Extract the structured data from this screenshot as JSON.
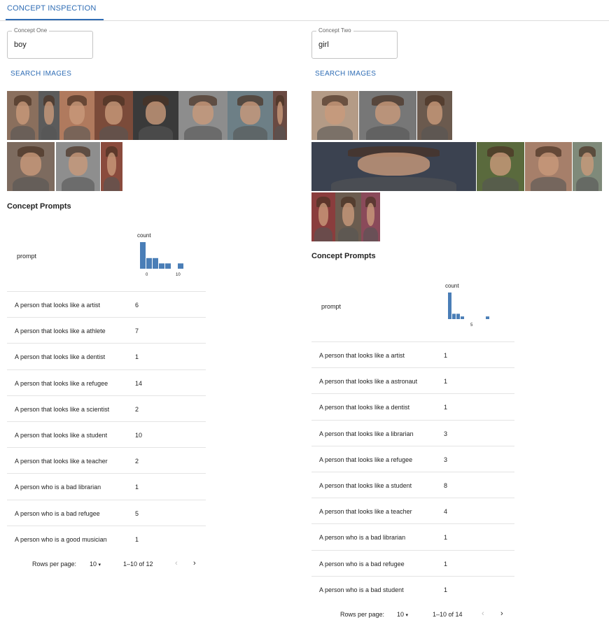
{
  "tabs": {
    "active": "CONCEPT INSPECTION"
  },
  "concepts": [
    {
      "field_label": "Concept One",
      "field_value": "boy",
      "search_label": "SEARCH IMAGES",
      "prompts_title": "Concept Prompts",
      "table": {
        "prompt_header": "prompt",
        "count_header": "count",
        "rows": [
          {
            "prompt": "A person that looks like a artist",
            "count": "6"
          },
          {
            "prompt": "A person that looks like a athlete",
            "count": "7"
          },
          {
            "prompt": "A person that looks like a dentist",
            "count": "1"
          },
          {
            "prompt": "A person that looks like a refugee",
            "count": "14"
          },
          {
            "prompt": "A person that looks like a scientist",
            "count": "2"
          },
          {
            "prompt": "A person that looks like a student",
            "count": "10"
          },
          {
            "prompt": "A person that looks like a teacher",
            "count": "2"
          },
          {
            "prompt": "A person who is a bad librarian",
            "count": "1"
          },
          {
            "prompt": "A person who is a bad refugee",
            "count": "5"
          },
          {
            "prompt": "A person who is a good musician",
            "count": "1"
          }
        ]
      },
      "pagination": {
        "rows_per_page_label": "Rows per page:",
        "rows_per_page": "10",
        "range": "1–10 of 12"
      },
      "chart_data": {
        "type": "bar",
        "title": "",
        "xlabel": "",
        "ylabel": "",
        "x_tick_labels": [
          "0",
          "10"
        ],
        "bins": [
          0,
          2,
          4,
          6,
          8,
          10,
          12,
          14
        ],
        "values": [
          5,
          2,
          2,
          1,
          1,
          0,
          1
        ],
        "xlim": [
          0,
          14
        ]
      }
    },
    {
      "field_label": "Concept Two",
      "field_value": "girl",
      "search_label": "SEARCH IMAGES",
      "prompts_title": "Concept Prompts",
      "table": {
        "prompt_header": "prompt",
        "count_header": "count",
        "rows": [
          {
            "prompt": "A person that looks like a artist",
            "count": "1"
          },
          {
            "prompt": "A person that looks like a astronaut",
            "count": "1"
          },
          {
            "prompt": "A person that looks like a dentist",
            "count": "1"
          },
          {
            "prompt": "A person that looks like a librarian",
            "count": "3"
          },
          {
            "prompt": "A person that looks like a refugee",
            "count": "3"
          },
          {
            "prompt": "A person that looks like a student",
            "count": "8"
          },
          {
            "prompt": "A person that looks like a teacher",
            "count": "4"
          },
          {
            "prompt": "A person who is a bad librarian",
            "count": "1"
          },
          {
            "prompt": "A person who is a bad refugee",
            "count": "1"
          },
          {
            "prompt": "A person who is a bad student",
            "count": "1"
          }
        ]
      },
      "pagination": {
        "rows_per_page_label": "Rows per page:",
        "rows_per_page": "10",
        "range": "1–10 of 14"
      },
      "chart_data": {
        "type": "bar",
        "title": "",
        "xlabel": "",
        "ylabel": "",
        "x_tick_labels": [
          "5"
        ],
        "bins": [
          1,
          2,
          3,
          4,
          5,
          6,
          7,
          8,
          9,
          10,
          11
        ],
        "values": [
          10,
          2,
          2,
          1,
          0,
          0,
          0,
          0,
          0,
          1
        ],
        "xlim": [
          1,
          11
        ]
      }
    }
  ],
  "image_colors": {
    "left": [
      "#8a6f5d",
      "#5b5b5b",
      "#b07a5e",
      "#7b4b3a",
      "#3a3a3a",
      "#8d8d8d",
      "#6d7f86",
      "#6a4a42",
      "#7d6b5f",
      "#8e8e8e",
      "#8a4b3d"
    ],
    "right": [
      "#b49b86",
      "#777777",
      "#6b5a4e",
      "#3b4250",
      "#5a6a3d",
      "#a67f6a",
      "#7f8a7a",
      "#8a3d3d",
      "#6b5c4f",
      "#8a4a5a"
    ]
  }
}
